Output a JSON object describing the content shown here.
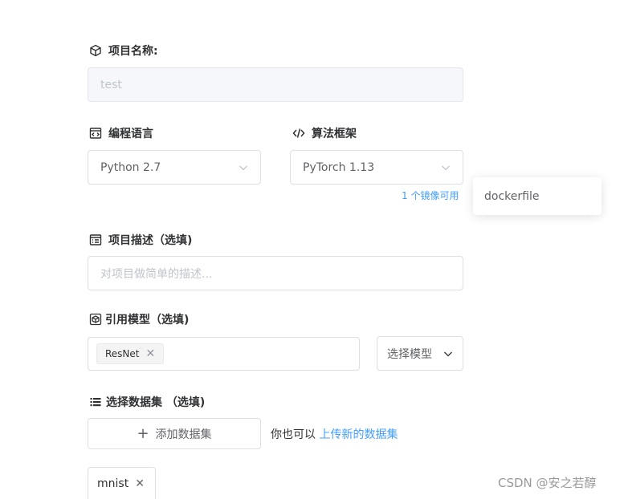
{
  "project_name": {
    "label": "项目名称:",
    "value": "test",
    "icon": "cube-icon"
  },
  "language": {
    "label": "编程语言",
    "value": "Python 2.7",
    "icon": "code-window-icon"
  },
  "framework": {
    "label": "算法框架",
    "value": "PyTorch 1.13",
    "icon": "code-brackets-icon",
    "image_hint": "1 个镜像可用"
  },
  "popover": {
    "item": "dockerfile"
  },
  "description": {
    "label": "项目描述（选填)",
    "placeholder": "对项目做简单的描述..."
  },
  "model": {
    "label": "引用模型（选填)",
    "tag": "ResNet",
    "select_label": "选择模型"
  },
  "dataset": {
    "label": "选择数据集 （选填)",
    "add_button": "添加数据集",
    "upload_prefix": "你也可以",
    "upload_link": "上传新的数据集",
    "tag": "mnist"
  },
  "watermark": "CSDN @安之若醇",
  "colors": {
    "accent": "#409eff",
    "border": "#dcdfe6",
    "disabled_bg": "#f5f7fa"
  }
}
